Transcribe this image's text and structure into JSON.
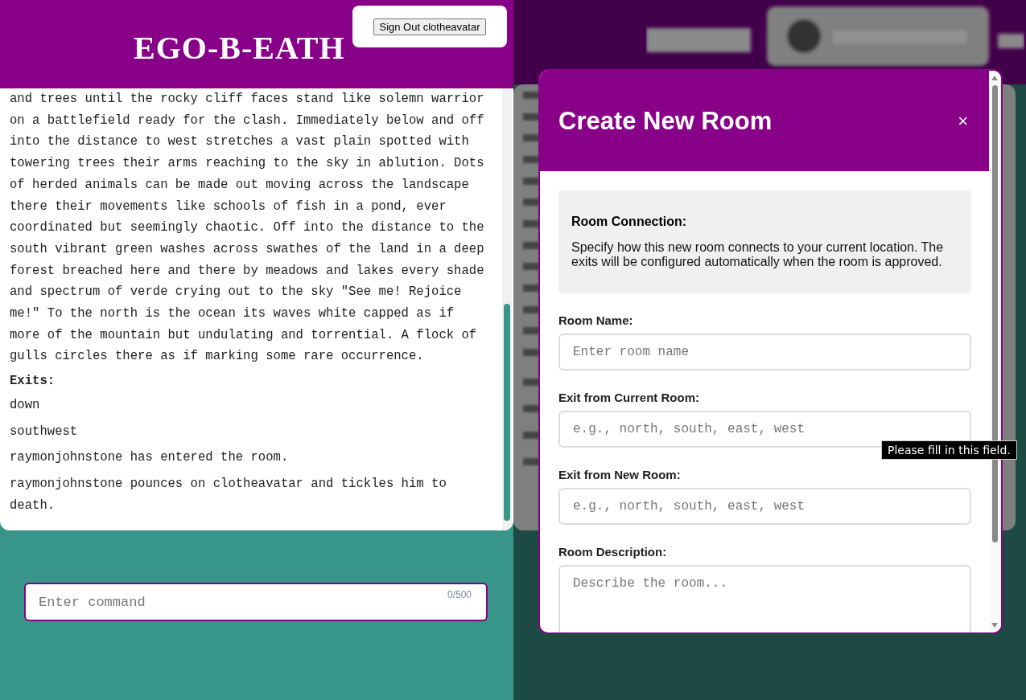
{
  "game_view": {
    "logo": "EGO-B-EATH",
    "sign_out_button": "Sign Out clotheavatar",
    "story": {
      "description": "and trees until the rocky cliff faces stand like solemn warrior on a battlefield ready for the clash. Immediately below and off into the distance to west stretches a vast plain spotted with towering trees their arms reaching to the sky in ablution. Dots of herded animals can be made out moving across the landscape there their movements like schools of fish in a pond, ever coordinated but seemingly chaotic. Off into the distance to the south vibrant green washes across swathes of the land in a deep forest breached here and there by meadows and lakes every shade and spectrum of verde crying out to the sky \"See me! Rejoice me!\" To the north is the ocean its waves white capped as if more of the mountain but undulating and torrential. A flock of gulls circles there as if marking some rare occurrence.",
      "exits_heading": "Exits:",
      "exits": [
        "down",
        "southwest"
      ],
      "messages": [
        "raymonjohnstone has entered the room.",
        "raymonjohnstone pounces on clotheavatar and tickles him to death."
      ]
    },
    "command": {
      "placeholder": "Enter command",
      "counter": "0/500"
    }
  },
  "modal": {
    "title": "Create New Room",
    "close": "×",
    "info": {
      "heading": "Room Connection:",
      "text": "Specify how this new room connects to your current location. The exits will be configured automatically when the room is approved."
    },
    "fields": [
      {
        "kind": "input",
        "label": "Room Name:",
        "placeholder": "Enter room name"
      },
      {
        "kind": "input",
        "label": "Exit from Current Room:",
        "placeholder": "e.g., north, south, east, west"
      },
      {
        "kind": "input",
        "label": "Exit from New Room:",
        "placeholder": "e.g., north, south, east, west"
      },
      {
        "kind": "textarea",
        "label": "Room Description:",
        "placeholder": "Describe the room..."
      }
    ]
  },
  "tooltip": "Please fill in this field."
}
